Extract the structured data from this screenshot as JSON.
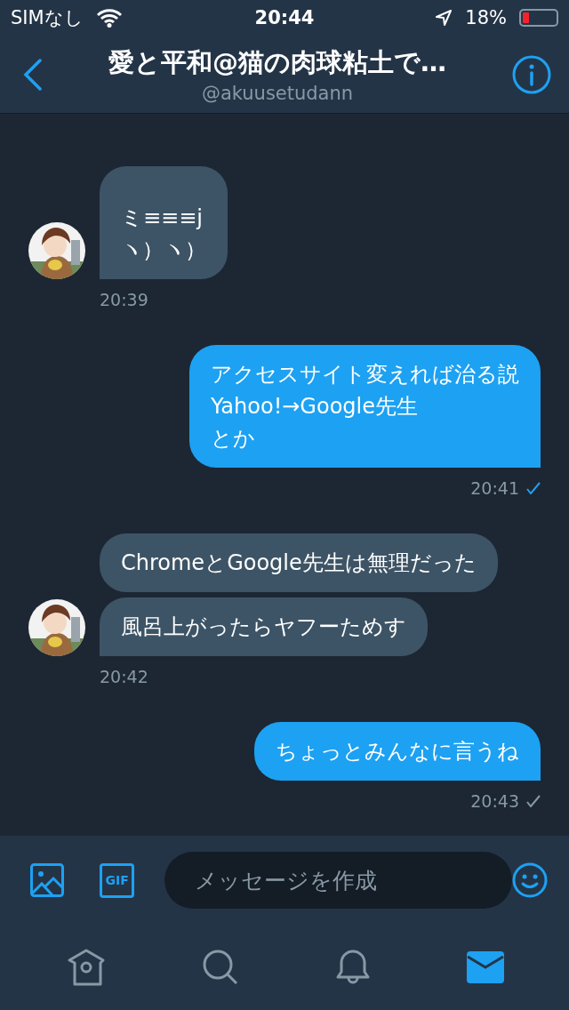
{
  "status_bar": {
    "carrier": "SIMなし",
    "time": "20:44",
    "battery": "18%"
  },
  "header": {
    "title": "愛と平和@猫の肉球粘土で…",
    "handle": "@akuusetudann"
  },
  "messages": [
    {
      "kind": "incoming",
      "bubbles": [
        [
          "ミ≡≡≡j",
          "ヽ）ヽ）"
        ]
      ],
      "time": "20:39"
    },
    {
      "kind": "outgoing",
      "bubbles": [
        [
          "アクセスサイト変えれば治る説",
          "Yahoo!→Google先生",
          "とか"
        ]
      ],
      "time": "20:41",
      "read": true
    },
    {
      "kind": "incoming",
      "bubbles": [
        [
          "ChromeとGoogle先生は無理だった"
        ],
        [
          "風呂上がったらヤフーためす"
        ]
      ],
      "time": "20:42"
    },
    {
      "kind": "outgoing",
      "bubbles": [
        [
          "ちょっとみんなに言うね"
        ]
      ],
      "time": "20:43",
      "read": false
    }
  ],
  "composer": {
    "placeholder": "メッセージを作成",
    "gif_label": "GIF"
  },
  "tab_bar": [
    {
      "kind": "home",
      "selected": false
    },
    {
      "kind": "search",
      "selected": false
    },
    {
      "kind": "notifications",
      "selected": false
    },
    {
      "kind": "messages",
      "selected": true
    }
  ]
}
